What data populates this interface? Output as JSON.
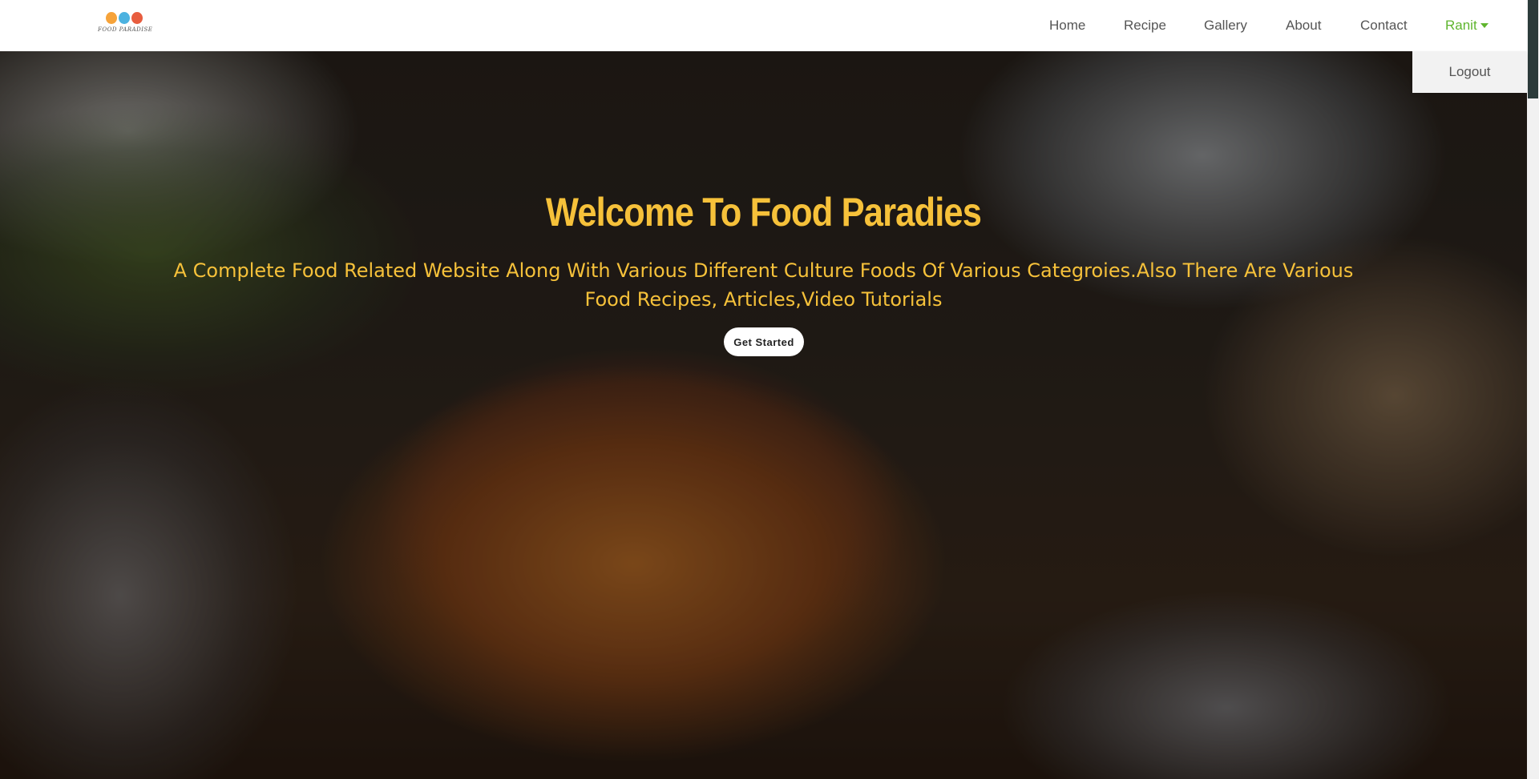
{
  "brand": {
    "logo_text": "FOOD PARADISE",
    "logo_colors": [
      "#f6a33a",
      "#4cb2e0",
      "#e85d3f"
    ]
  },
  "nav": {
    "items": [
      {
        "label": "Home"
      },
      {
        "label": "Recipe"
      },
      {
        "label": "Gallery"
      },
      {
        "label": "About"
      },
      {
        "label": "Contact"
      }
    ],
    "user": {
      "label": "Ranit",
      "icon": "caret-down-icon"
    },
    "dropdown": {
      "logout_label": "Logout"
    }
  },
  "hero": {
    "title": "Welcome To Food Paradies",
    "subtitle": "A Complete Food Related Website Along With Various Different Culture Foods Of Various Categroies.Also There Are Various Food Recipes, Articles,Video Tutorials",
    "cta_label": "Get Started"
  },
  "colors": {
    "accent": "#f6c13a",
    "user_green": "#5fb52e",
    "nav_text": "#555555"
  }
}
